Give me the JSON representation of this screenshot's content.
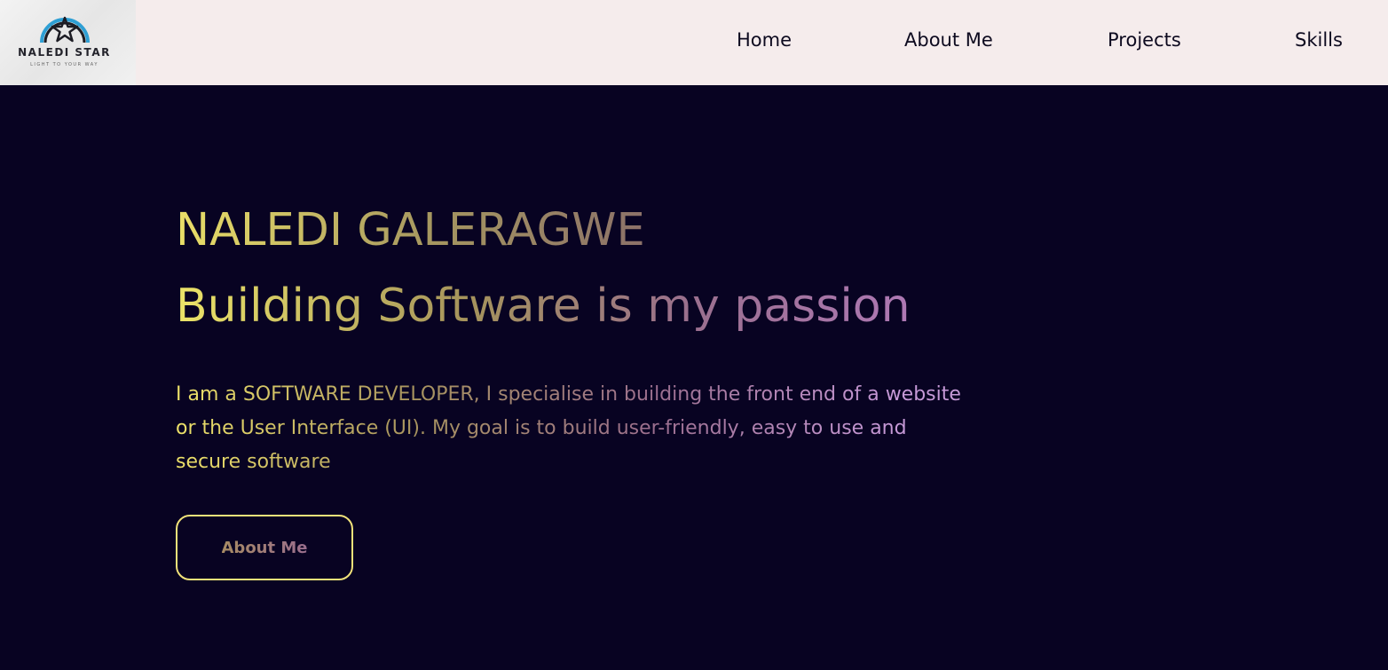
{
  "header": {
    "logo_name": "NALEDI STAR",
    "logo_tagline": "LIGHT TO YOUR WAY",
    "nav": {
      "home": "Home",
      "about": "About Me",
      "projects": "Projects",
      "skills": "Skills"
    }
  },
  "hero": {
    "name": "NALEDI GALERAGWE",
    "headline": "Building Software is my passion",
    "description": "I am a SOFTWARE DEVELOPER, I specialise in building the front end of a website or the User Interface (UI). My goal is to build user-friendly, easy to use and secure software",
    "button_label": "About Me"
  },
  "colors": {
    "page_background": "#080322",
    "navbar_background": "#f5ecec",
    "nav_text": "#0d0a1f",
    "gradient_start": "#ece168",
    "gradient_mid": "#a99561",
    "gradient_end": "#b67fc6",
    "button_border": "#f1e27a",
    "logo_ring_blue": "#2e9fd4"
  },
  "icons": {
    "logo": "star-in-arc-icon"
  }
}
